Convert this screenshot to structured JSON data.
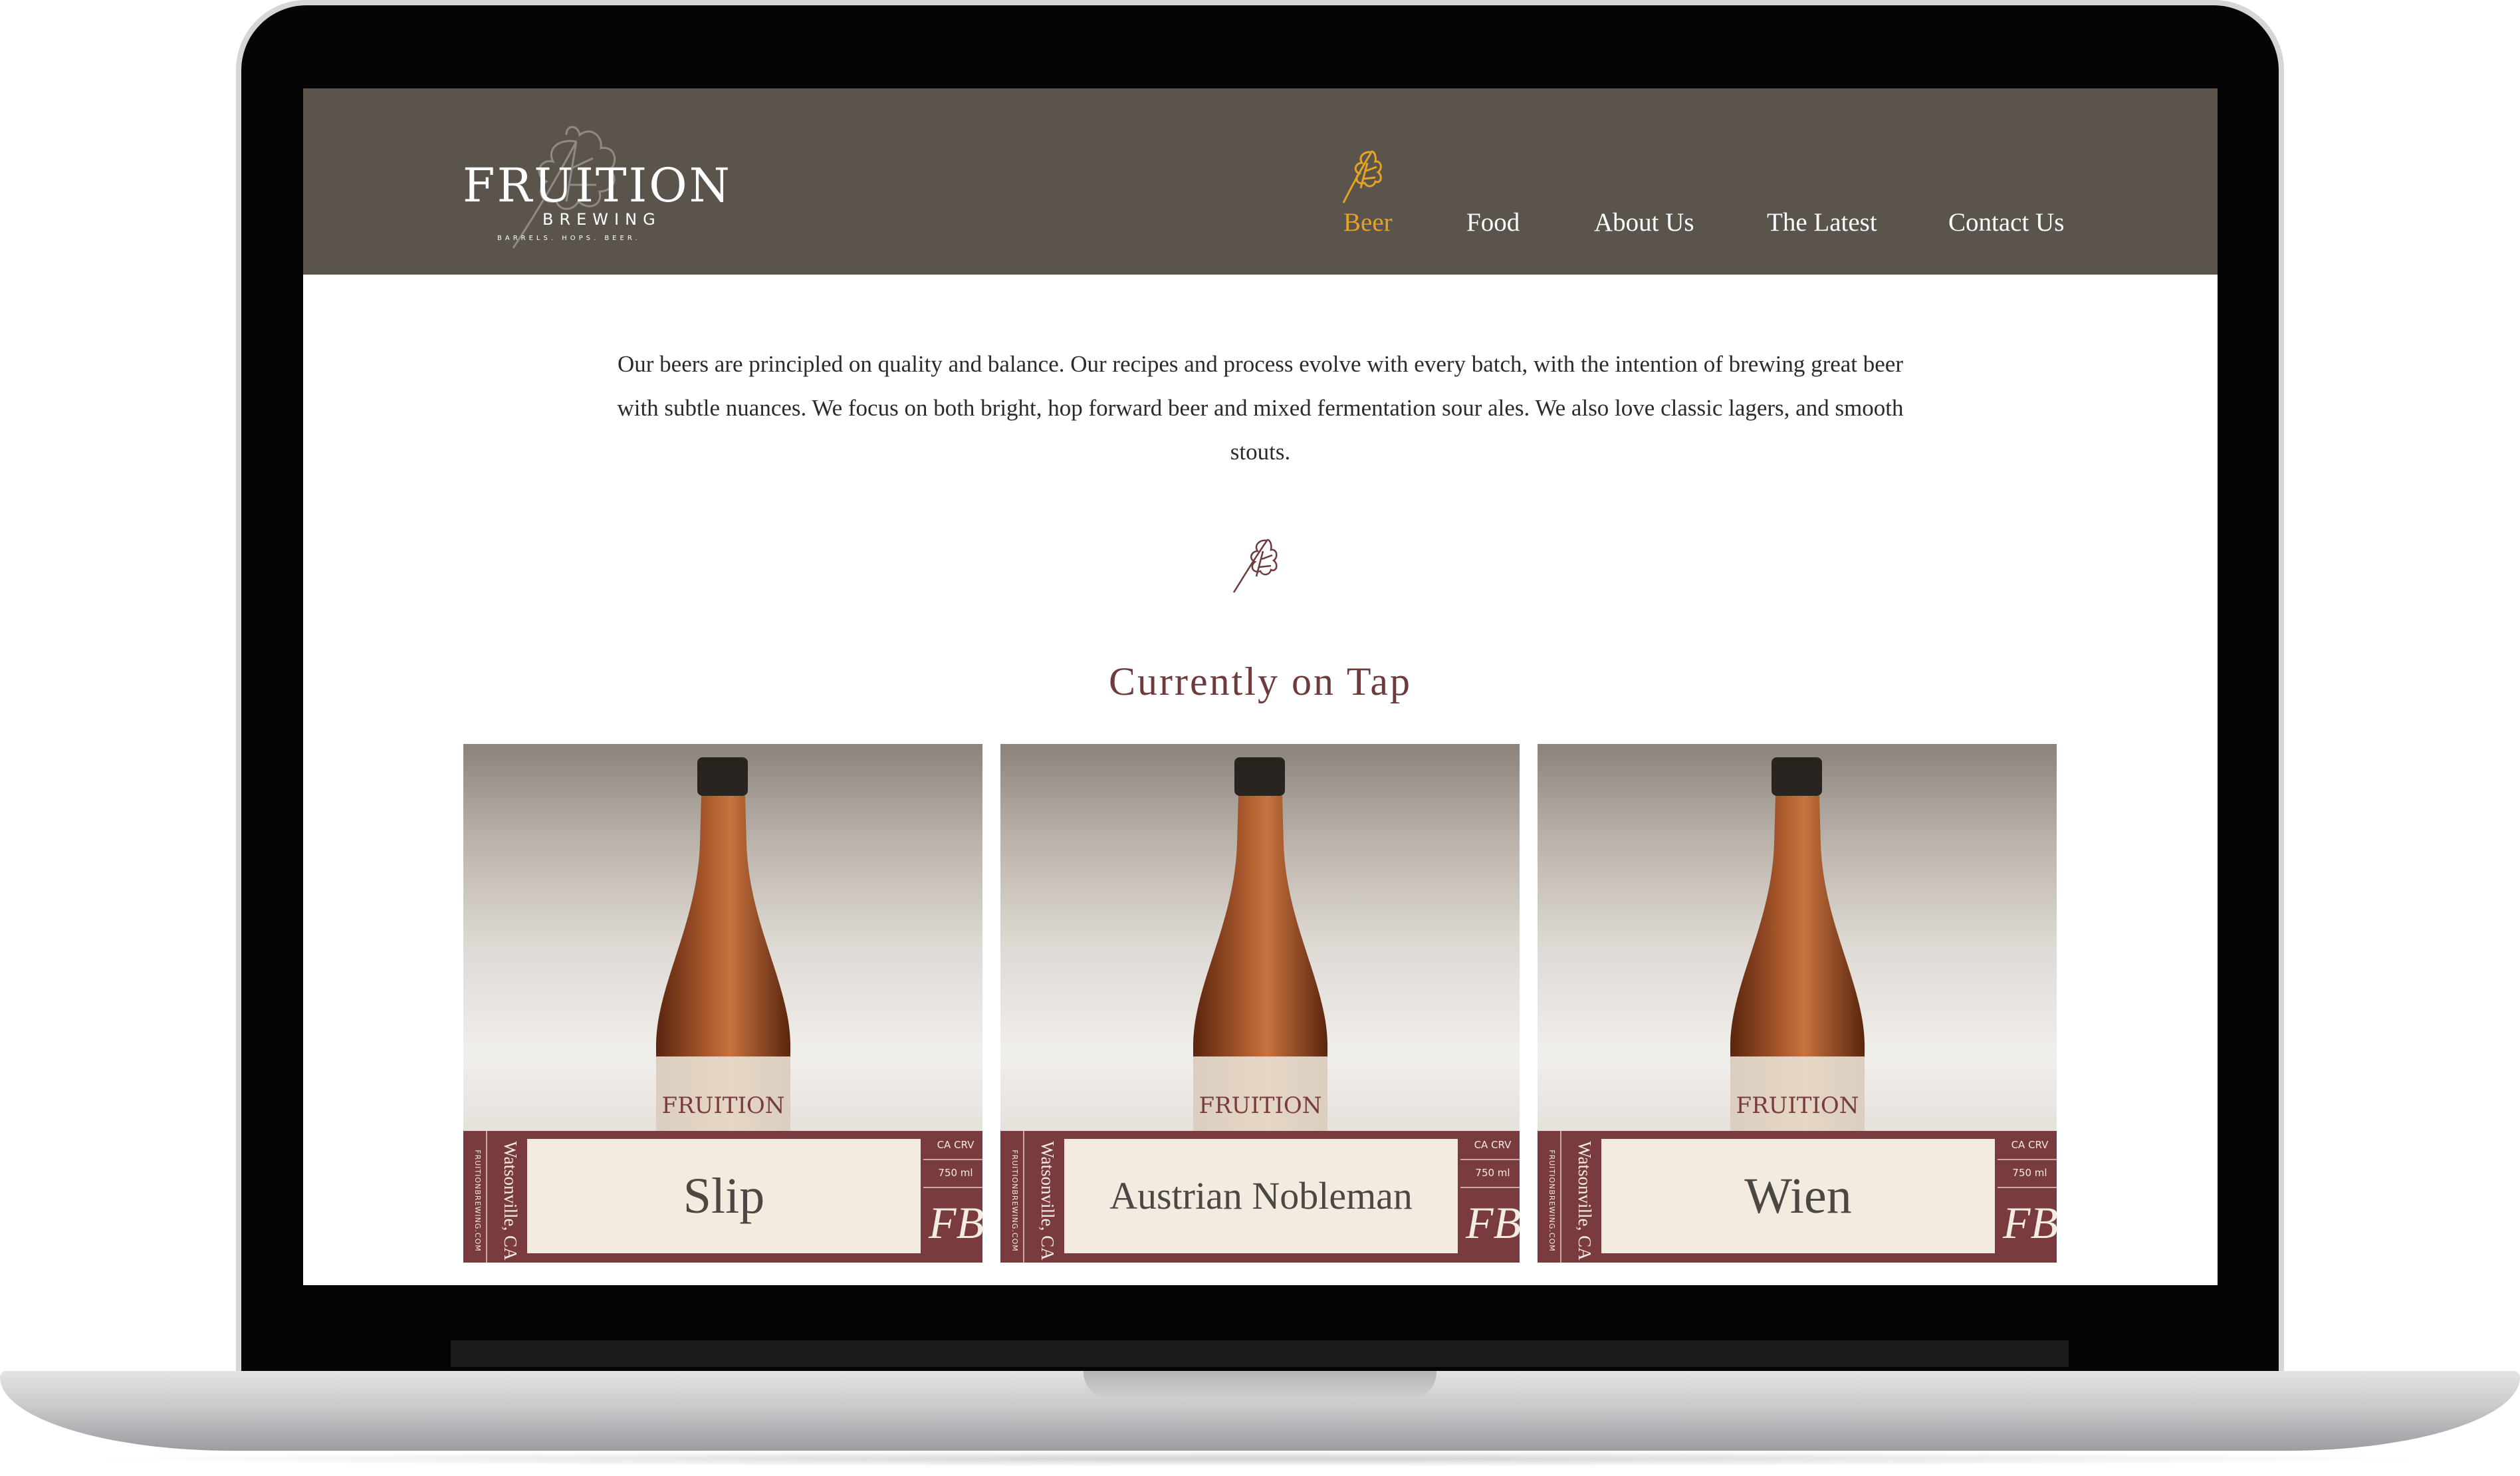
{
  "brand": {
    "name": "FRUITION",
    "sub": "BREWING",
    "tagline": "BARRELS. HOPS. BEER."
  },
  "nav": {
    "items": [
      {
        "label": "Beer",
        "active": true
      },
      {
        "label": "Food",
        "active": false
      },
      {
        "label": "About Us",
        "active": false
      },
      {
        "label": "The Latest",
        "active": false
      },
      {
        "label": "Contact Us",
        "active": false
      }
    ]
  },
  "intro": "Our beers are principled on quality and balance. Our recipes and process evolve with every batch, with the intention of brewing great beer with subtle nuances. We focus on both bright, hop forward beer and mixed fermentation sour ales. We also love classic lagers, and smooth stouts.",
  "section_title": "Currently on Tap",
  "beers": [
    {
      "name": "Slip",
      "city": "Watsonville, CA",
      "site": "FRUITIONBREWING.COM",
      "crv": "CA CRV",
      "volume": "750 ml",
      "monogram": "FB"
    },
    {
      "name": "Austrian Nobleman",
      "city": "Watsonville, CA",
      "site": "FRUITIONBREWING.COM",
      "crv": "CA CRV",
      "volume": "750 ml",
      "monogram": "FB"
    },
    {
      "name": "Wien",
      "city": "Watsonville, CA",
      "site": "FRUITIONBREWING.COM",
      "crv": "CA CRV",
      "volume": "750 ml",
      "monogram": "FB"
    }
  ],
  "colors": {
    "header_bg": "#5a544d",
    "nav_active": "#e5a323",
    "title": "#6f3a3c",
    "label_strip": "#7a3b3e",
    "label_panel": "#f3ebdf"
  }
}
